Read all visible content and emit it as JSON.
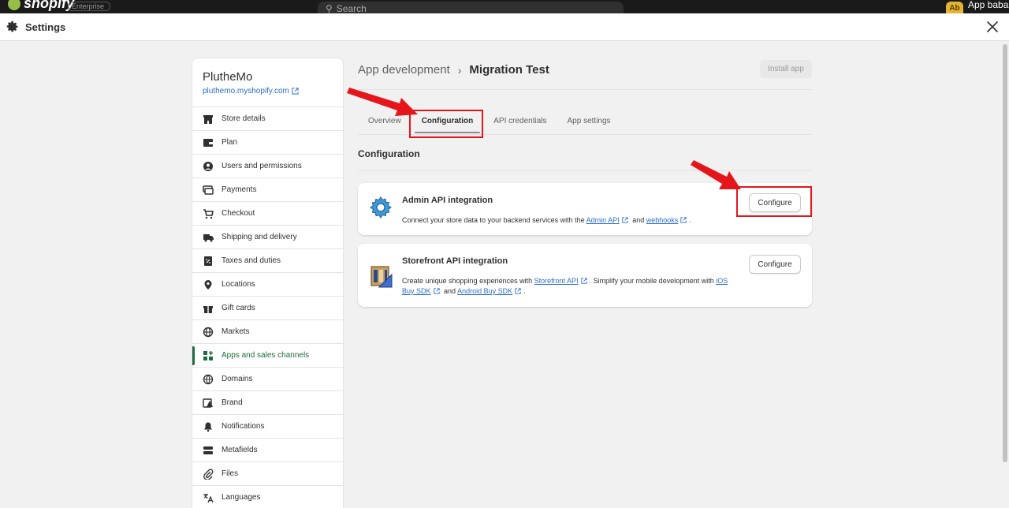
{
  "topbar": {
    "logo_text": "shopify",
    "store_badge": "Enterprise",
    "search_placeholder": "Search",
    "avatar_initials": "Ab",
    "user_name": "App baba"
  },
  "settings": {
    "title": "Settings"
  },
  "store": {
    "name": "PlutheMo",
    "url": "pluthemo.myshopify.com"
  },
  "nav": {
    "items": [
      {
        "label": "Store details",
        "icon": "store-icon"
      },
      {
        "label": "Plan",
        "icon": "plan-icon"
      },
      {
        "label": "Users and permissions",
        "icon": "user-icon"
      },
      {
        "label": "Payments",
        "icon": "payments-icon"
      },
      {
        "label": "Checkout",
        "icon": "cart-icon"
      },
      {
        "label": "Shipping and delivery",
        "icon": "truck-icon"
      },
      {
        "label": "Taxes and duties",
        "icon": "tax-icon"
      },
      {
        "label": "Locations",
        "icon": "location-icon"
      },
      {
        "label": "Gift cards",
        "icon": "gift-icon"
      },
      {
        "label": "Markets",
        "icon": "globe-icon"
      },
      {
        "label": "Apps and sales channels",
        "icon": "apps-icon",
        "active": true
      },
      {
        "label": "Domains",
        "icon": "domain-icon"
      },
      {
        "label": "Brand",
        "icon": "brand-icon"
      },
      {
        "label": "Notifications",
        "icon": "bell-icon"
      },
      {
        "label": "Metafields",
        "icon": "metafields-icon"
      },
      {
        "label": "Files",
        "icon": "paperclip-icon"
      },
      {
        "label": "Languages",
        "icon": "translate-icon"
      }
    ]
  },
  "main": {
    "breadcrumb_parent": "App development",
    "breadcrumb_current": "Migration Test",
    "install_label": "Install app",
    "tabs": [
      {
        "label": "Overview"
      },
      {
        "label": "Configuration",
        "active": true
      },
      {
        "label": "API credentials"
      },
      {
        "label": "App settings"
      }
    ],
    "section_title": "Configuration",
    "cards": {
      "admin": {
        "title": "Admin API integration",
        "desc_prefix": "Connect your store data to your backend services with the",
        "link1": "Admin API",
        "and": "and",
        "link2": "webhooks",
        "desc_suffix": ".",
        "button": "Configure"
      },
      "storefront": {
        "title": "Storefront API integration",
        "desc_prefix": "Create unique shopping experiences with",
        "link1": "Storefront API",
        "desc_mid": ". Simplify your mobile development with",
        "link2": "iOS Buy SDK",
        "and": "and",
        "link3": "Android Buy SDK",
        "desc_suffix": ".",
        "button": "Configure"
      }
    }
  },
  "colors": {
    "annotation_red": "#e5161b",
    "active_green": "#1f6b3f",
    "link_blue": "#2c6ecb"
  }
}
